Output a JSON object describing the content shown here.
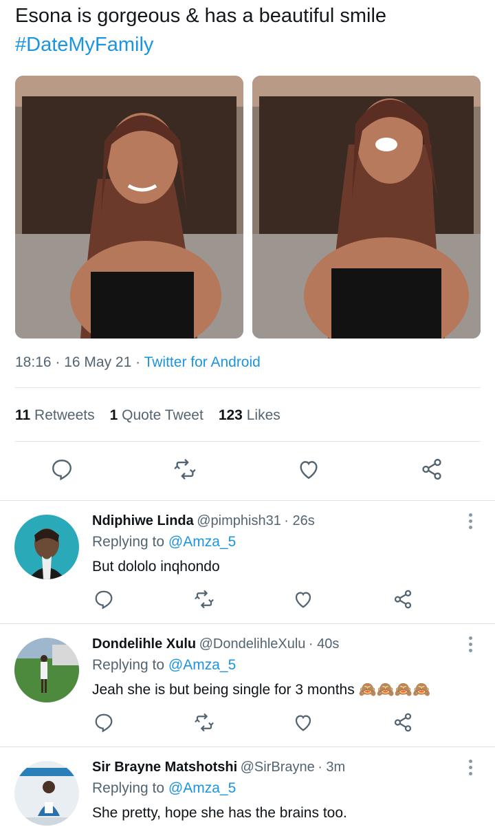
{
  "tweet": {
    "text_line1": "Esona is gorgeous & has a beautiful smile",
    "hashtag": "#DateMyFamily",
    "time": "18:16",
    "date": "16 May 21",
    "source": "Twitter for Android",
    "stats": {
      "retweets_count": "11",
      "retweets_label": "Retweets",
      "quotes_count": "1",
      "quotes_label": "Quote Tweet",
      "likes_count": "123",
      "likes_label": "Likes"
    },
    "icons": [
      "reply-icon",
      "retweet-icon",
      "like-icon",
      "share-icon"
    ]
  },
  "replies": [
    {
      "name": "Ndiphiwe Linda",
      "handle": "@pimphish31",
      "time": "26s",
      "replying_prefix": "Replying to",
      "replying_to": "@Amza_5",
      "text": "But dololo inqhondo",
      "emoji": ""
    },
    {
      "name": "Dondelihle Xulu",
      "handle": "@DondelihleXulu",
      "time": "40s",
      "replying_prefix": "Replying to",
      "replying_to": "@Amza_5",
      "text": "Jeah she is but being single for 3 months",
      "emoji": "🙈🙈🙈🙈"
    },
    {
      "name": "Sir Brayne Matshotshi",
      "handle": "@SirBrayne",
      "time": "3m",
      "replying_prefix": "Replying to",
      "replying_to": "@Amza_5",
      "text": "She pretty, hope she has the brains too.",
      "emoji": ""
    }
  ],
  "colors": {
    "accent": "#1b95e0",
    "muted": "#536471",
    "divider": "#dfe3e7",
    "icon": "#536471"
  }
}
